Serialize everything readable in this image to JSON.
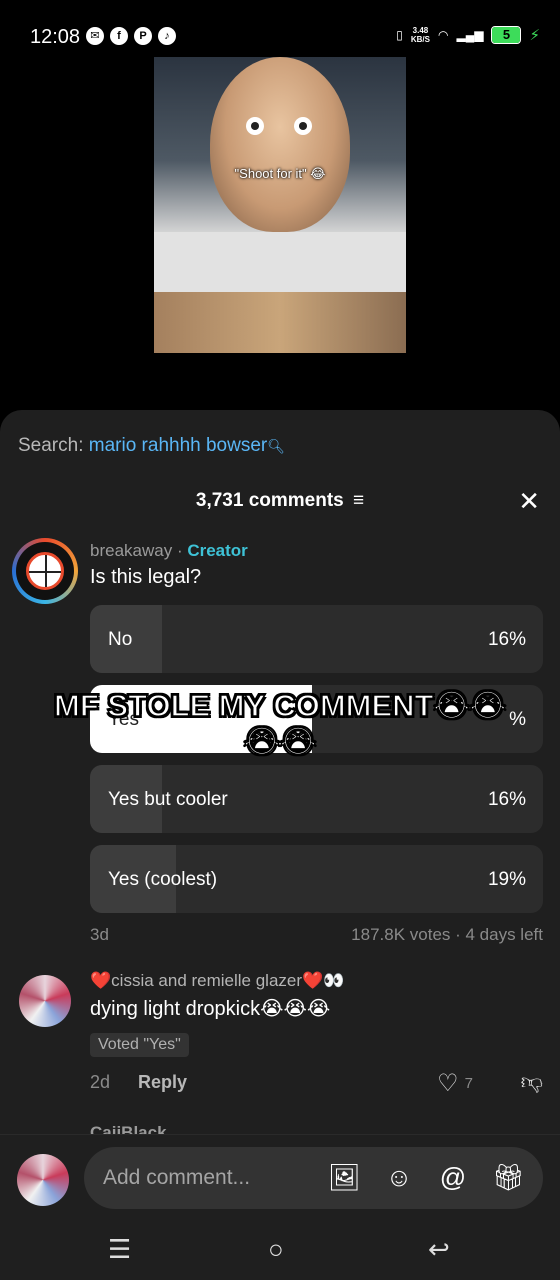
{
  "status_bar": {
    "time": "12:08",
    "net_speed": "3.48\nKB/S",
    "battery": "5",
    "signal": "G"
  },
  "video": {
    "caption": "\"Shoot for it\" 😂"
  },
  "search": {
    "prefix": "Search: ",
    "term": "mario rahhhh bowser"
  },
  "comments_header": {
    "count_label": "3,731 comments"
  },
  "comment1": {
    "username": "breakaway",
    "separator": " · ",
    "badge": "Creator",
    "text": "Is this legal?",
    "poll": {
      "options": [
        {
          "label": "No",
          "pct": "16%",
          "fill": 0.16
        },
        {
          "label": "Yes",
          "pct": "%",
          "fill": 0.49
        },
        {
          "label": "Yes but cooler",
          "pct": "16%",
          "fill": 0.16
        },
        {
          "label": "Yes (coolest)",
          "pct": "19%",
          "fill": 0.19
        }
      ],
      "age": "3d",
      "meta": "187.8K votes · 4 days left"
    }
  },
  "overlay": {
    "line1": "MF STOLE MY COMMENT😭😭",
    "line2": "😭😭"
  },
  "comment2": {
    "username": "cissia and remielle glazer",
    "heart_left": "❤️",
    "heart_right": "❤️👀",
    "text": "dying light dropkick😭😭😭",
    "voted": "Voted \"Yes\"",
    "age": "2d",
    "reply": "Reply",
    "likes": "7"
  },
  "next_comment": {
    "username": "CaiiBlack"
  },
  "input": {
    "placeholder": "Add comment..."
  }
}
